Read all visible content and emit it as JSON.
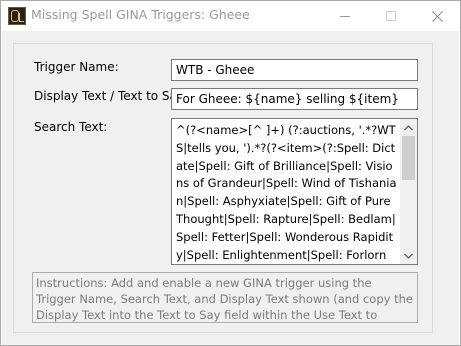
{
  "window": {
    "title": "Missing Spell GINA Triggers: Gheee",
    "icon": "app-icon",
    "controls": {
      "minimize": "minimize-icon",
      "maximize": "maximize-icon",
      "close": "close-icon"
    }
  },
  "form": {
    "trigger_name_label": "Trigger Name:",
    "trigger_name_value": "WTB - Gheee",
    "display_text_label": "Display Text / Text to Say:",
    "display_text_value": "For Gheee: ${name} selling ${item}",
    "search_text_label": "Search Text:",
    "search_text_value": "^(?<name>[^ ]+) (?:auctions, '.*?WTS|tells you, ').*?(?<item>(?:Spell: Dictate|Spell: Gift of Brilliance|Spell: Visions of Grandeur|Spell: Wind of Tishanian|Spell: Asphyxiate|Spell: Gift of Pure Thought|Spell: Rapture|Spell: Bedlam|Spell: Fetter|Spell: Wonderous Rapidity|Spell: Enlightenment|Spell: Forlorn Deeds|Spell: Tashanian|Spell: Umbra|Spell: Augment|Spell: Overwhelming Splendor|Spell:",
    "instructions": "Instructions: Add and enable a new GINA trigger using the Trigger Name, Search Text, and Display Text shown (and copy the Display Text into the Text to Say field within the Use Text to Speech section as well)."
  },
  "colors": {
    "background": "#f0f0f0",
    "title_text": "#9a9a9a",
    "instruction_text": "#7a7a7a"
  }
}
